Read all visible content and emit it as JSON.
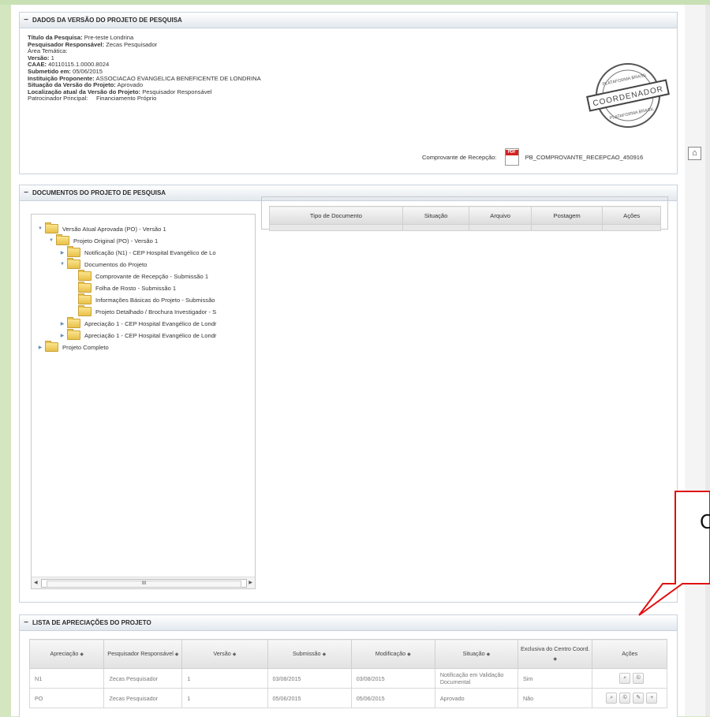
{
  "panel_dados": {
    "title": "DADOS DA VERSÃO DO PROJETO DE PESQUISA",
    "titulo_label": "Título da Pesquisa:",
    "titulo_value": "Pre-teste Londrina",
    "pesq_label": "Pesquisador Responsável:",
    "pesq_value": "Zecas Pesquisador",
    "area_label": "Área Temática:",
    "versao_label": "Versão:",
    "versao_value": "1",
    "caae_label": "CAAE:",
    "caae_value": "40110115.1.0000.8024",
    "submetido_label": "Submetido em:",
    "submetido_value": "05/06/2015",
    "inst_label": "Instituição Proponente:",
    "inst_value": "ASSOCIACAO EVANGELICA BENEFICENTE DE LONDRINA",
    "situacao_label": "Situação da Versão do Projeto:",
    "situacao_value": "Aprovado",
    "local_label": "Localização atual da Versão do Projeto:",
    "local_value": "Pesquisador Responsável",
    "patro_label": "Patrocinador Principal:",
    "patro_value": "Financiamento Próprio",
    "receipt_label": "Comprovante de Recepção:",
    "receipt_file": "PB_COMPROVANTE_RECEPCAO_450916",
    "stamp_top": "PLATAFORMA BRASIL",
    "stamp_center": "COORDENADOR",
    "stamp_bottom": "PLATAFORMA BRASIL"
  },
  "panel_docs": {
    "title": "DOCUMENTOS DO PROJETO DE PESQUISA",
    "tree": [
      {
        "label": "Versão Atual Aprovada (PO) - Versão 1",
        "toggle": "▼"
      },
      {
        "label": "Projeto Original (PO) - Versão 1",
        "toggle": "▼"
      },
      {
        "label": "Notificação (N1) - CEP Hospital Evangélico de Lo",
        "toggle": "▶"
      },
      {
        "label": "Documentos do Projeto",
        "toggle": "▼"
      },
      {
        "label": "Comprovante de Recepção - Submissão 1",
        "toggle": ""
      },
      {
        "label": "Folha de Rosto - Submissão 1",
        "toggle": ""
      },
      {
        "label": "Informações Básicas do Projeto - Submissão",
        "toggle": ""
      },
      {
        "label": "Projeto Detalhado / Brochura Investigador - S",
        "toggle": ""
      },
      {
        "label": "Apreciação 1 - CEP Hospital Evangélico de Londr",
        "toggle": "▶"
      },
      {
        "label": "Apreciação 1 - CEP Hospital Evangélico de Londr",
        "toggle": "▶"
      },
      {
        "label": "Projeto Completo",
        "toggle": "▶"
      }
    ],
    "scroll_thumb": "III",
    "columns": [
      "Tipo de Documento",
      "Situação",
      "Arquivo",
      "Postagem",
      "Ações"
    ]
  },
  "panel_apreciacoes": {
    "title": "LISTA DE APRECIAÇÕES DO PROJETO",
    "columns": [
      "Apreciação",
      "Pesquisador Responsável",
      "Versão",
      "Submissão",
      "Modificação",
      "Situação",
      "Exclusiva do Centro Coord.",
      "Ações"
    ],
    "rows": [
      {
        "apreciacao": "N1",
        "pesquisador": "Zecas Pesquisador",
        "versao": "1",
        "submissao": "03/08/2015",
        "modificacao": "03/08/2015",
        "situacao": "Notificação em Validação Documental",
        "exclusiva": "Sim"
      },
      {
        "apreciacao": "PO",
        "pesquisador": "Zecas Pesquisador",
        "versao": "1",
        "submissao": "05/06/2015",
        "modificacao": "05/06/2015",
        "situacao": "Aprovado",
        "exclusiva": "Não"
      }
    ]
  },
  "callout": {
    "text": "C"
  },
  "icons": {
    "home": "home-icon",
    "pdf": "pdf-icon"
  }
}
